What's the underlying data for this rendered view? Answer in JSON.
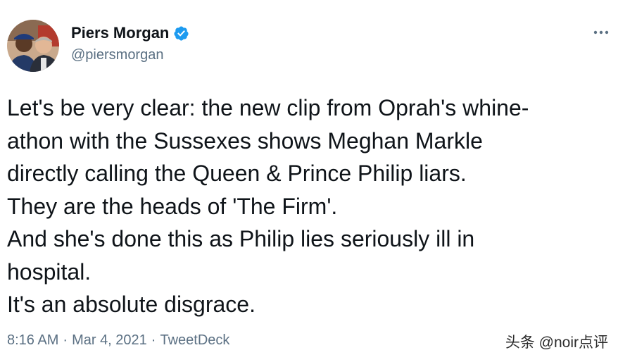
{
  "author": {
    "display_name": "Piers Morgan",
    "handle": "@piersmorgan",
    "verified": true,
    "avatar_icon": "avatar-two-people-photo"
  },
  "menu": {
    "icon": "more-horizontal-icon"
  },
  "tweet": {
    "lines": [
      "Let's be very clear: the new clip from Oprah's whine-",
      "athon with the Sussexes shows Meghan Markle",
      "directly calling the Queen & Prince Philip liars.",
      "They are the heads of 'The Firm'.",
      "And she's done this as Philip lies seriously ill in",
      "hospital.",
      "It's an absolute disgrace."
    ]
  },
  "meta": {
    "time": "8:16 AM",
    "separator": "·",
    "date": "Mar 4, 2021",
    "source": "TweetDeck"
  },
  "watermark": {
    "text": "头条 @noir点评"
  },
  "colors": {
    "text": "#0f1419",
    "secondary": "#5b7083",
    "verified": "#1d9bf0"
  }
}
